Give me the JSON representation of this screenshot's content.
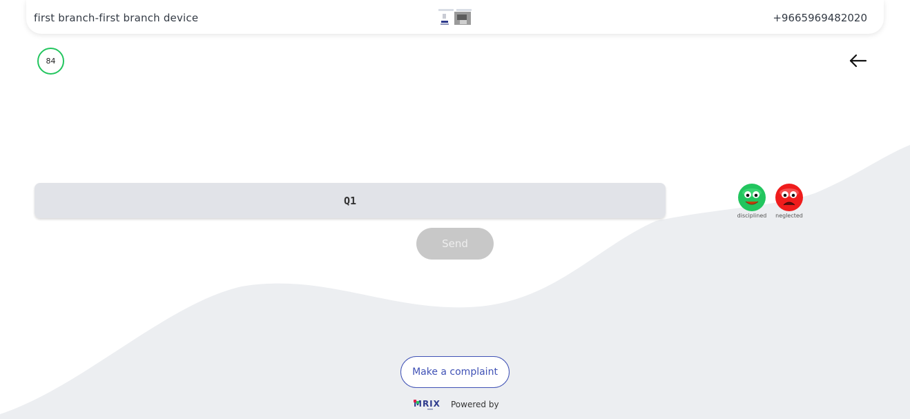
{
  "header": {
    "branch_device": "first branch-first branch device",
    "phone": "+9665969482020"
  },
  "timer": {
    "value": "84"
  },
  "question": {
    "text": "Q1"
  },
  "options": [
    {
      "label": "disciplined",
      "icon": "happy-face-icon",
      "color": "#22c55e"
    },
    {
      "label": "neglected",
      "icon": "angry-face-icon",
      "color": "#ef1c1c"
    }
  ],
  "buttons": {
    "send_label": "Send",
    "complaint_label": "Make a complaint"
  },
  "footer": {
    "powered_by": "Powered by",
    "brand": "MRIX"
  },
  "colors": {
    "accent": "#3f51b5",
    "timer_ring": "#22c55e",
    "send_disabled": "#c8c8c8",
    "wave": "#eceef1"
  }
}
